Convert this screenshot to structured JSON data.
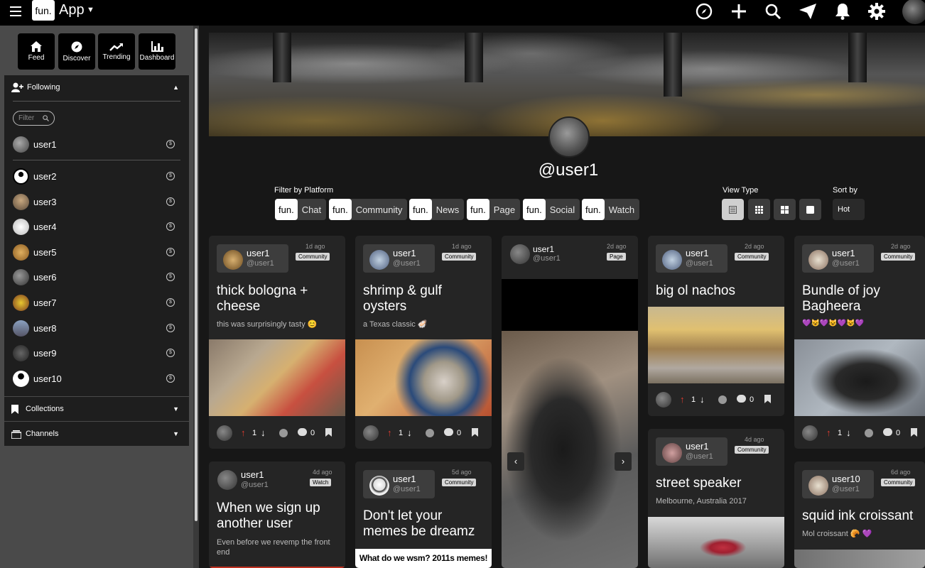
{
  "app": {
    "logo": "fun.",
    "title": "App"
  },
  "topbar": {
    "icons": [
      "compass-icon",
      "plus-icon",
      "search-icon",
      "send-icon",
      "bell-icon",
      "gear-icon"
    ]
  },
  "sidebar": {
    "nav": [
      {
        "label": "Feed",
        "icon": "home-icon"
      },
      {
        "label": "Discover",
        "icon": "compass-icon"
      },
      {
        "label": "Trending",
        "icon": "trend-icon"
      },
      {
        "label": "Dashboard",
        "icon": "chart-icon"
      }
    ],
    "following": {
      "label": "Following",
      "filter_placeholder": "Filter"
    },
    "users": [
      "user1",
      "user2",
      "user3",
      "user4",
      "user5",
      "user6",
      "user7",
      "user8",
      "user9",
      "user10"
    ],
    "collections": "Collections",
    "channels": "Channels"
  },
  "profile": {
    "handle": "@user1"
  },
  "filters": {
    "platform_label": "Filter by Platform",
    "platforms": [
      {
        "mini": "fun.",
        "name": "Chat"
      },
      {
        "mini": "fun.",
        "name": "Community"
      },
      {
        "mini": "fun.",
        "name": "News"
      },
      {
        "mini": "fun.",
        "name": "Page"
      },
      {
        "mini": "fun.",
        "name": "Social"
      },
      {
        "mini": "fun.",
        "name": "Watch"
      }
    ],
    "view_label": "View Type",
    "sort_label": "Sort by",
    "sort_value": "Hot"
  },
  "cards": [
    {
      "user": "user1",
      "handle": "@user1",
      "ago": "1d ago",
      "tag": "Community",
      "title": "thick bologna + cheese",
      "sub": "this was surprisingly tasty 😊",
      "up": "1",
      "comments": "0"
    },
    {
      "user": "user1",
      "handle": "@user1",
      "ago": "1d ago",
      "tag": "Community",
      "title": "shrimp & gulf oysters",
      "sub": "a Texas classic 🦪",
      "up": "1",
      "comments": "0"
    },
    {
      "user": "user1",
      "handle": "@user1",
      "ago": "2d ago",
      "tag": "Page"
    },
    {
      "user": "user1",
      "handle": "@user1",
      "ago": "2d ago",
      "tag": "Community",
      "title": "big ol nachos",
      "up": "1",
      "comments": "0"
    },
    {
      "user": "user1",
      "handle": "@user1",
      "ago": "2d ago",
      "tag": "Community",
      "title": "Bundle of joy Bagheera",
      "sub": "💜😺💜😺💜😺💜",
      "up": "1",
      "comments": "0"
    },
    {
      "user": "user1",
      "handle": "@user1",
      "ago": "4d ago",
      "tag": "Watch",
      "title": "When we sign up another user",
      "sub": "Even before we revemp the front end"
    },
    {
      "user": "user1",
      "handle": "@user1",
      "ago": "5d ago",
      "tag": "Community",
      "title": "Don't let your memes be dreamz",
      "meme": "What do we wsm? 2011s memes!"
    },
    {
      "user": "user1",
      "handle": "@user1",
      "ago": "4d ago",
      "tag": "Community",
      "title": "street speaker",
      "sub": "Melbourne, Australia 2017"
    },
    {
      "user": "user10",
      "handle": "@user1",
      "ago": "6d ago",
      "tag": "Community",
      "title": "squid ink croissant",
      "sub": "Mol croissant 🥐 💜"
    }
  ]
}
